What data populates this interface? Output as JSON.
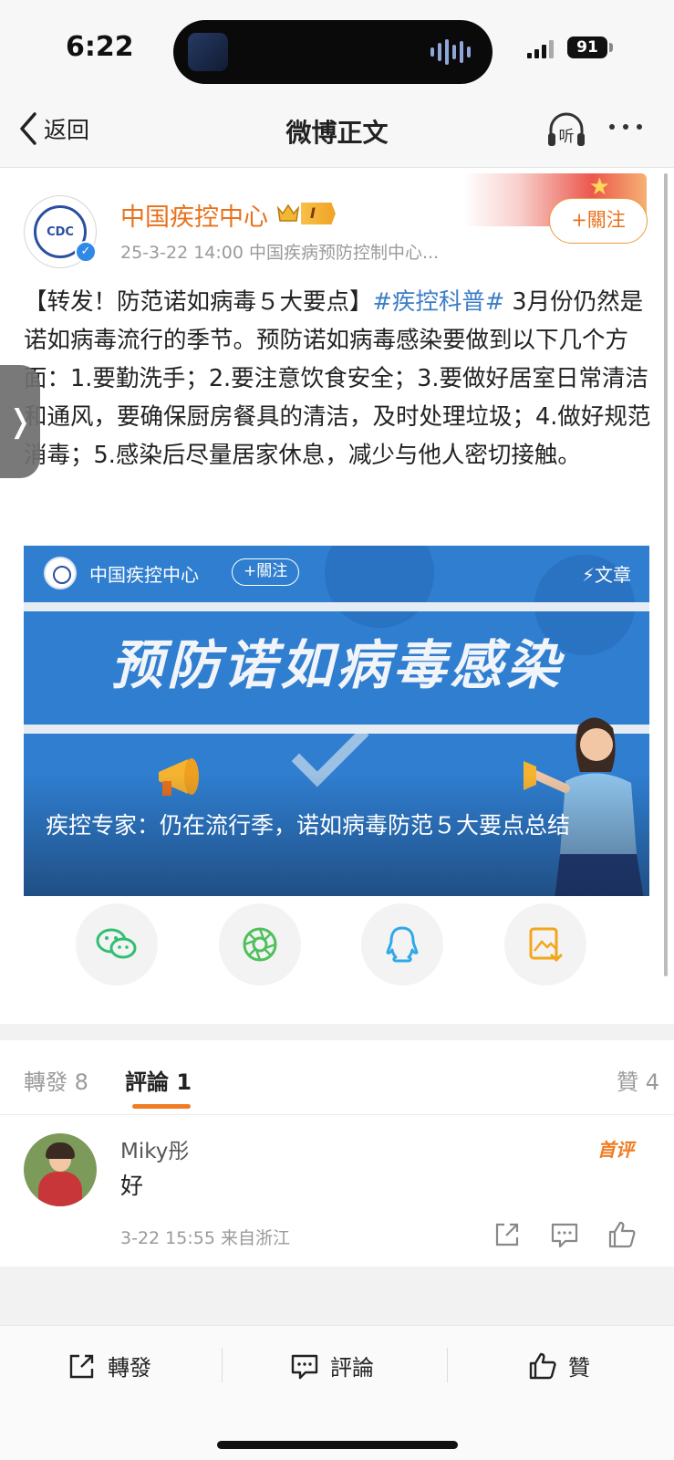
{
  "status_bar": {
    "time": "6:22",
    "battery": "91"
  },
  "nav": {
    "back_label": "返回",
    "title": "微博正文",
    "listen_label": "听"
  },
  "post": {
    "author": "中国疾控中心",
    "level": "I",
    "meta": "25-3-22 14:00  中国疾病预防控制中心...",
    "follow_label": "+關注",
    "text_before": "【转发！防范诺如病毒５大要点】",
    "hashtag": "#疾控科普#",
    "text_after": " 3月份仍然是诺如病毒流行的季节。预防诺如病毒感染要做到以下几个方面：1.要勤洗手；2.要注意饮食安全；3.要做好居室日常清洁和通风，要确保厨房餐具的清洁，及时处理垃圾；4.做好规范消毒；5.感染后尽量居家休息，减少与他人密切接触。",
    "side_tab": "❭"
  },
  "article": {
    "source_name": "中国疾控中心",
    "follow_label": "+關注",
    "type_label": "⚡文章",
    "headline": "预防诺如病毒感染",
    "caption": "疾控专家：仍在流行季，诺如病毒防范５大要点总结"
  },
  "share": [
    "wechat-icon",
    "moments-icon",
    "qq-icon",
    "save-image-icon"
  ],
  "tabs": {
    "repost": "轉發 8",
    "comment": "評論 1",
    "like": "贊 4"
  },
  "comment": {
    "user": "Miky彤",
    "badge": "首评",
    "text": "好",
    "meta": "3-22 15:55  来自浙江"
  },
  "bottom_bar": {
    "repost": "轉發",
    "comment": "評論",
    "like": "贊"
  },
  "colors": {
    "accent": "#f07c24",
    "link": "#3c7ec7",
    "article_bg": "#2f7ed0"
  }
}
